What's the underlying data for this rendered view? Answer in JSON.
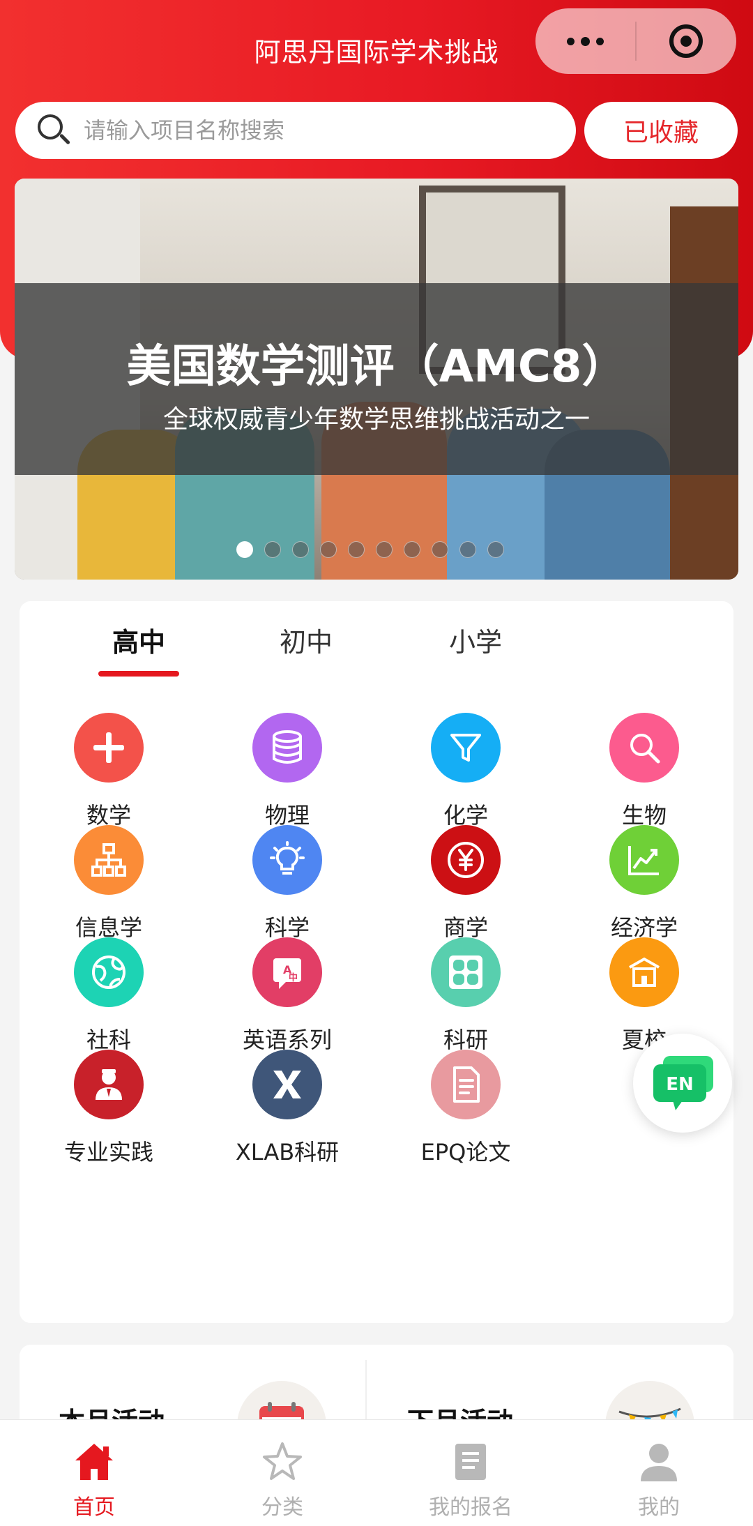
{
  "header": {
    "title": "阿思丹国际学术挑战"
  },
  "search": {
    "placeholder": "请输入项目名称搜索",
    "favorites_label": "已收藏"
  },
  "banner": {
    "title": "美国数学测评（AMC8）",
    "subtitle": "全球权威青少年数学思维挑战活动之一",
    "slide_count": 10,
    "active_slide": 1
  },
  "tabs": [
    {
      "label": "高中",
      "active": true
    },
    {
      "label": "初中",
      "active": false
    },
    {
      "label": "小学",
      "active": false
    }
  ],
  "categories": [
    {
      "label": "数学",
      "icon": "plus-icon",
      "color": "#f3524a"
    },
    {
      "label": "物理",
      "icon": "database-icon",
      "color": "#b267f0"
    },
    {
      "label": "化学",
      "icon": "funnel-icon",
      "color": "#15aef5"
    },
    {
      "label": "生物",
      "icon": "magnifier-icon",
      "color": "#fc5b8e"
    },
    {
      "label": "信息学",
      "icon": "org-chart-icon",
      "color": "#fb8c37"
    },
    {
      "label": "科学",
      "icon": "lightbulb-icon",
      "color": "#4f86f2"
    },
    {
      "label": "商学",
      "icon": "yen-icon",
      "color": "#cc1014"
    },
    {
      "label": "经济学",
      "icon": "trend-chart-icon",
      "color": "#6fd037"
    },
    {
      "label": "社科",
      "icon": "globe-icon",
      "color": "#1dd3b4"
    },
    {
      "label": "英语系列",
      "icon": "translate-icon",
      "color": "#e23e66"
    },
    {
      "label": "科研",
      "icon": "grid-icon",
      "color": "#58cfae"
    },
    {
      "label": "夏校",
      "icon": "school-icon",
      "color": "#fb9a11"
    },
    {
      "label": "专业实践",
      "icon": "worker-icon",
      "color": "#c8212a"
    },
    {
      "label": "XLAB科研",
      "icon": "x-logo-icon",
      "color": "#3f5679"
    },
    {
      "label": "EPQ论文",
      "icon": "document-icon",
      "color": "#e89a9f"
    }
  ],
  "activities": {
    "this_month": "本月活动",
    "next_month": "下月活动"
  },
  "fab": {
    "label": "EN"
  },
  "bottom_nav": [
    {
      "label": "首页",
      "icon": "home-icon",
      "active": true
    },
    {
      "label": "分类",
      "icon": "star-icon",
      "active": false
    },
    {
      "label": "我的报名",
      "icon": "clipboard-icon",
      "active": false
    },
    {
      "label": "我的",
      "icon": "user-icon",
      "active": false
    }
  ],
  "colors": {
    "brand_red": "#e5181f",
    "hero_gradient_start": "#f2302f",
    "hero_gradient_end": "#cf0a12"
  }
}
